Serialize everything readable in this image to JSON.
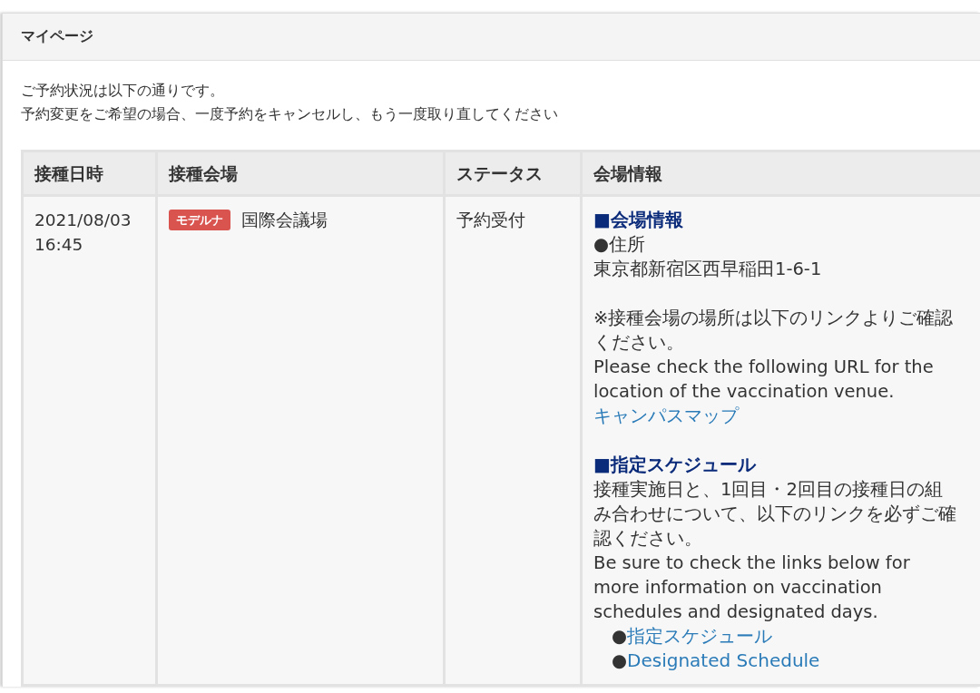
{
  "panel": {
    "title": "マイページ"
  },
  "intro": [
    "ご予約状況は以下の通りです。",
    "予約変更をご希望の場合、一度予約をキャンセルし、もう一度取り直してください"
  ],
  "table": {
    "columns": [
      "接種日時",
      "接種会場",
      "ステータス",
      "会場情報"
    ],
    "rows": [
      {
        "datetime": "2021/08/03 16:45",
        "vaccine_badge": "モデルナ",
        "venue": "国際会議場",
        "status": "予約受付",
        "info": [
          {
            "heading": "■会場情報",
            "groups": [
              [
                {
                  "kind": "text",
                  "text": "●住所"
                },
                {
                  "kind": "text",
                  "text": "東京都新宿区西早稲田1-6-1"
                }
              ],
              [
                {
                  "kind": "text",
                  "text": "※接種会場の場所は以下のリンクよりご確認ください。"
                },
                {
                  "kind": "text",
                  "text": "Please check the following URL for the location of the vaccination venue."
                },
                {
                  "kind": "link",
                  "text": "キャンパスマップ"
                }
              ]
            ]
          },
          {
            "heading": "■指定スケジュール",
            "groups": [
              [
                {
                  "kind": "text",
                  "text": "接種実施日と、1回目・2回目の接種日の組み合わせについて、以下のリンクを必ずご確認ください。"
                },
                {
                  "kind": "text",
                  "text": "Be sure to check the links below for more information on vaccination schedules and designated days."
                },
                {
                  "kind": "bullet-link",
                  "bullet": "●",
                  "text": "指定スケジュール"
                },
                {
                  "kind": "bullet-link",
                  "bullet": "●",
                  "text": "Designated Schedule"
                }
              ]
            ]
          }
        ]
      }
    ]
  }
}
